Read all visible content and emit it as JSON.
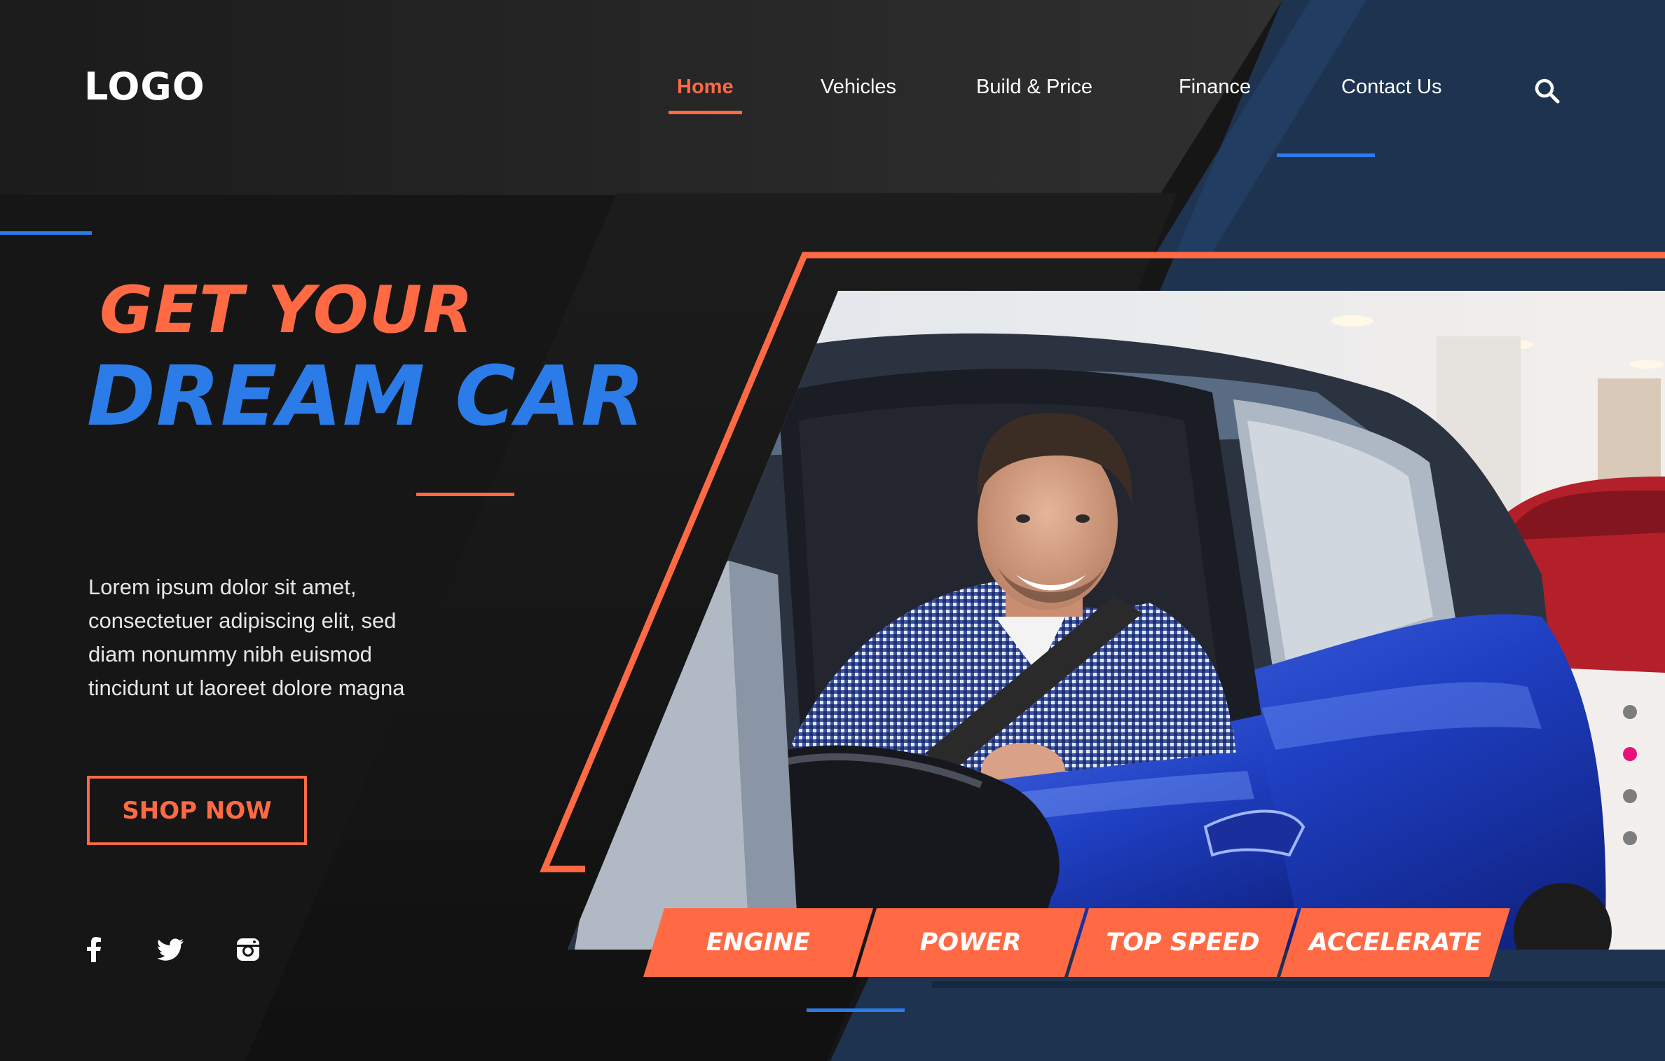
{
  "header": {
    "logo": "LOGO",
    "nav": [
      {
        "label": "Home",
        "active": true
      },
      {
        "label": "Vehicles"
      },
      {
        "label": "Build & Price"
      },
      {
        "label": "Finance"
      },
      {
        "label": "Contact Us"
      }
    ],
    "search_icon": "search-icon"
  },
  "hero": {
    "title_line1": "GET YOUR",
    "title_line2": "DREAM CAR",
    "description": [
      "Lorem ipsum dolor sit amet,",
      "consectetuer adipiscing elit, sed",
      "diam nonummy nibh euismod",
      "tincidunt ut laoreet dolore magna"
    ],
    "cta_label": "SHOP NOW"
  },
  "social_icons": [
    "facebook-icon",
    "twitter-icon",
    "instagram-icon"
  ],
  "features": [
    "ENGINE",
    "POWER",
    "TOP SPEED",
    "ACCELERATE"
  ],
  "carousel": {
    "total": 4,
    "active": 2
  },
  "colors": {
    "accent_orange": "#ff6a45",
    "accent_blue": "#2b7ce9",
    "navy": "#1d3350",
    "dark": "#141414",
    "active_dot": "#e6127a"
  }
}
